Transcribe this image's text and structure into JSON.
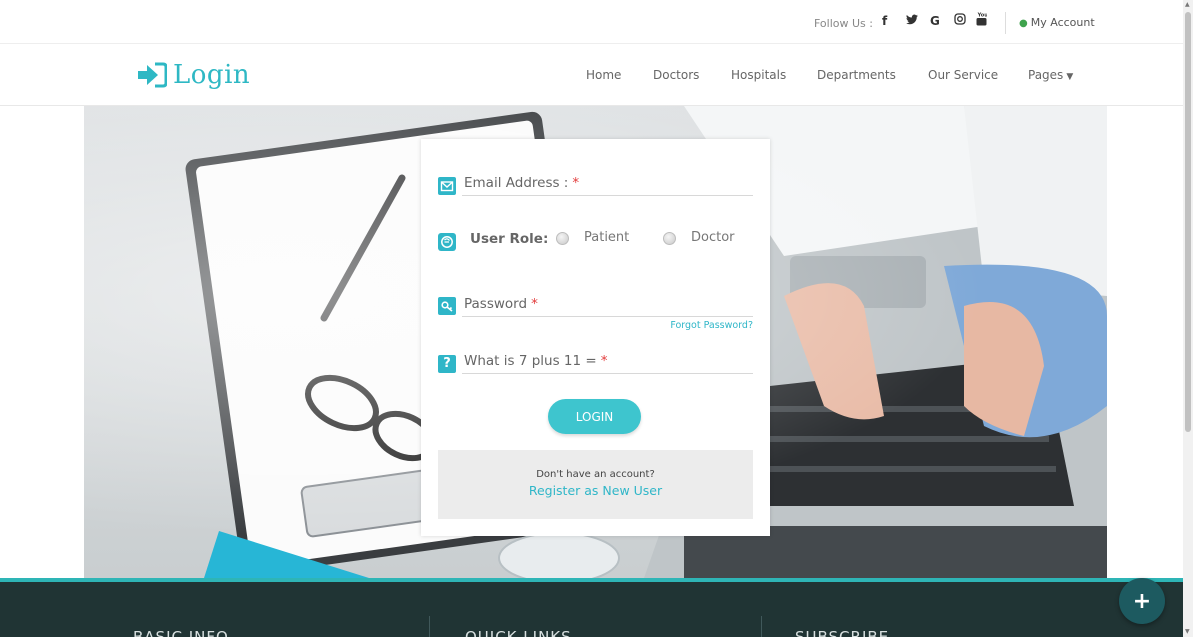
{
  "topbar": {
    "follow_label": "Follow Us :",
    "social": [
      {
        "name": "facebook-icon",
        "glyph": "f"
      },
      {
        "name": "twitter-icon",
        "glyph": "🐦"
      },
      {
        "name": "google-icon",
        "glyph": "G"
      },
      {
        "name": "instagram-icon",
        "glyph": "◎"
      },
      {
        "name": "youtube-icon",
        "glyph": "▣"
      }
    ],
    "account_label": "My Account"
  },
  "header": {
    "logo_text": "Login",
    "nav": [
      "Home",
      "Doctors",
      "Hospitals",
      "Departments",
      "Our Service",
      "Pages"
    ]
  },
  "form": {
    "email_label": "Email Address :",
    "role_label": "User Role:",
    "role_options": [
      "Patient",
      "Doctor"
    ],
    "password_label": "Password",
    "required_mark": "*",
    "forgot_label": "Forgot Password?",
    "captcha_label": "What is 7 plus 11 =",
    "login_button": "LOGIN",
    "register_question": "Don't have an account?",
    "register_link": "Register as New User"
  },
  "footer": {
    "columns": [
      "BASIC INFO",
      "QUICK LINKS",
      "SUBSCRIBE"
    ],
    "fab_glyph": "+"
  },
  "colors": {
    "accent": "#2eb8c4",
    "footer_bg": "#203434",
    "required": "#e23b3b"
  }
}
